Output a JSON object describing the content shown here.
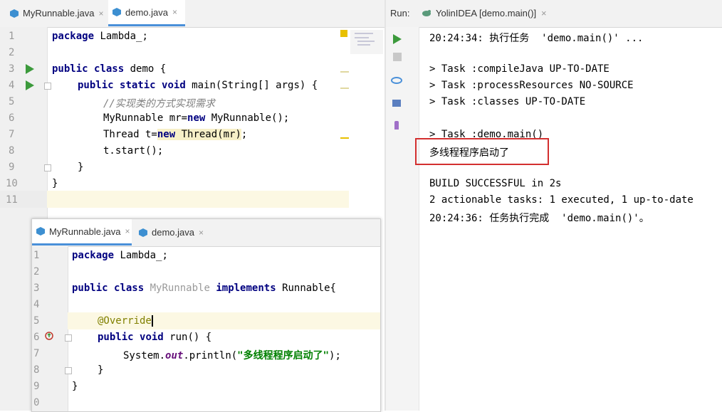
{
  "editor1": {
    "tabs": [
      {
        "label": "MyRunnable.java",
        "close": "×"
      },
      {
        "label": "demo.java",
        "close": "×"
      }
    ],
    "line_numbers": [
      "1",
      "2",
      "3",
      "4",
      "5",
      "6",
      "7",
      "8",
      "9",
      "10",
      "11"
    ],
    "lines": {
      "l1_kw": "package",
      "l1_rest": " Lambda_;",
      "l3_kw1": "public",
      "l3_kw2": "class",
      "l3_rest": " demo {",
      "l4_kw1": "public",
      "l4_kw2": "static",
      "l4_kw3": "void",
      "l4_rest": " main(String[] args) {",
      "l5_comment": "//实现类的方式实现需求",
      "l6_a": "MyRunnable mr=",
      "l6_kw": "new",
      "l6_b": " MyRunnable();",
      "l7_a": "Thread t=",
      "l7_kw": "new",
      "l7_b": " Thread(mr)",
      "l7_c": ";",
      "l8": "t.start();",
      "l9": "}",
      "l10": "}"
    }
  },
  "editor2": {
    "tabs": [
      {
        "label": "MyRunnable.java",
        "close": "×"
      },
      {
        "label": "demo.java",
        "close": "×"
      }
    ],
    "line_numbers": [
      "1",
      "2",
      "3",
      "4",
      "5",
      "6",
      "7",
      "8",
      "9",
      "0"
    ],
    "lines": {
      "l1_kw": "package",
      "l1_rest": " Lambda_;",
      "l3_kw1": "public",
      "l3_kw2": "class",
      "l3_cls": "MyRunnable",
      "l3_kw3": "implements",
      "l3_rest": " Runnable{",
      "l5_ann": "@Override",
      "l6_kw1": "public",
      "l6_kw2": "void",
      "l6_rest": " run() {",
      "l7_a": "System.",
      "l7_out": "out",
      "l7_b": ".println(",
      "l7_str": "\"多线程程序启动了\"",
      "l7_c": ");",
      "l8": "}",
      "l9": "}"
    }
  },
  "run_panel": {
    "label": "Run:",
    "tab_label": "YolinIDEA [demo.main()]",
    "tab_close": "×",
    "console": {
      "line1_time": "20:24:34:",
      "line1_cn": " 执行任务",
      "line1_rest": "  'demo.main()' ...",
      "task1": "> Task :compileJava UP-TO-DATE",
      "task2": "> Task :processResources NO-SOURCE",
      "task3": "> Task :classes UP-TO-DATE",
      "task4": "> Task :demo.main()",
      "output": "多线程程序启动了",
      "build": "BUILD SUCCESSFUL in 2s",
      "actionable": "2 actionable tasks: 1 executed, 1 up-to-date",
      "done_time": "20:24:36:",
      "done_cn": " 任务执行完成",
      "done_rest": "  'demo.main()'。"
    }
  },
  "colors": {
    "keyword": "#000080",
    "string": "#008000",
    "comment": "#808080",
    "run_green": "#3c9a3c",
    "highlight_box": "#d32f2f"
  }
}
